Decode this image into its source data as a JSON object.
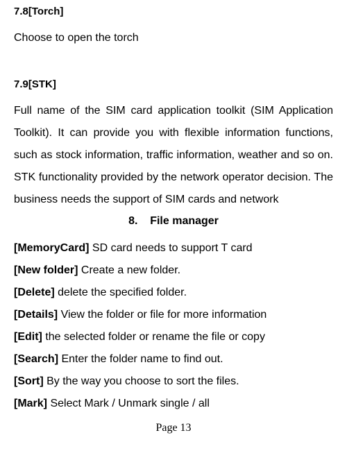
{
  "sec78": {
    "num": "7.8[",
    "title": "Torch",
    "close": "]"
  },
  "line78": "Choose to open the torch",
  "sec79": {
    "num": "7.9[",
    "title": "STK",
    "close": "]"
  },
  "para79": " Full name of the SIM card application toolkit (SIM Application Toolkit). It can provide you with flexible information functions, such as stock information, traffic information, weather and so on. STK functionality provided by the network operator decision. The business needs the support of SIM cards and network",
  "chapter8": {
    "num": "8.",
    "title": "File manager"
  },
  "defs": [
    {
      "term": "[MemoryCard]",
      "text": " SD card needs to support T card"
    },
    {
      "term": "[New folder]",
      "text": "   Create a new folder."
    },
    {
      "term": "[Delete]",
      "text": " delete the specified folder."
    },
    {
      "term": "[Details]",
      "text": " View the folder or file for more information"
    },
    {
      "term": "[Edit]",
      "text": " the selected folder or rename the file or copy"
    },
    {
      "term": "[Search]",
      "text": " Enter the folder name to find out."
    },
    {
      "term": "[Sort]",
      "text": " By the way you choose to sort the files."
    },
    {
      "term": "[Mark]",
      "text": " Select Mark / Unmark single / all"
    }
  ],
  "footer": "Page 13"
}
